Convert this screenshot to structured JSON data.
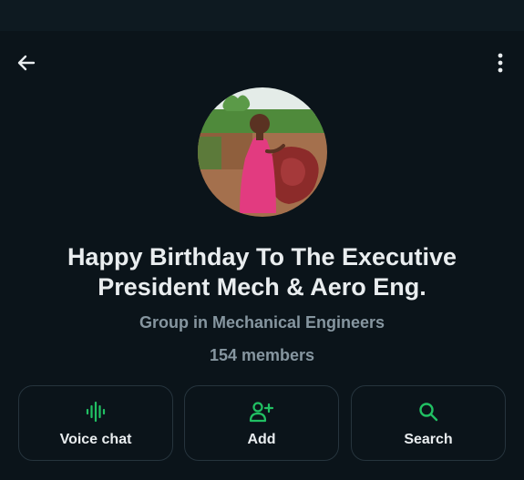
{
  "header": {
    "back_icon": "arrow-left-icon",
    "menu_icon": "more-vertical-icon"
  },
  "group": {
    "avatar_icon": "group-avatar-photo",
    "title_line1": "Happy Birthday To The Executive",
    "title_line2": "President Mech & Aero Eng.",
    "subtitle": "Group in Mechanical Engineers",
    "members": "154 members"
  },
  "actions": [
    {
      "label": "Voice chat",
      "icon": "voice-wave-icon"
    },
    {
      "label": "Add",
      "icon": "add-person-icon"
    },
    {
      "label": "Search",
      "icon": "search-icon"
    }
  ],
  "colors": {
    "background": "#0b141a",
    "accent_green": "#21c063",
    "muted_text": "#8696a0",
    "primary_text": "#e9edef",
    "button_border": "#26343d"
  }
}
